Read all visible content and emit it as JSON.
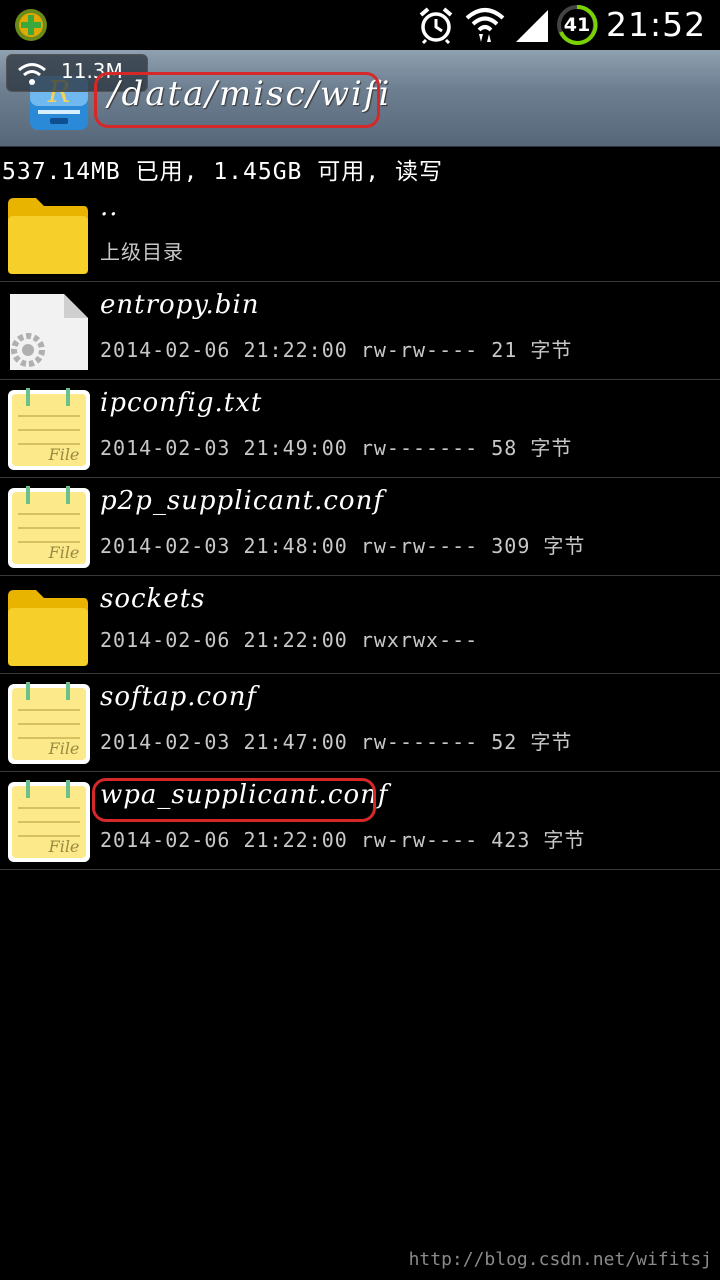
{
  "status_bar": {
    "battery_level": "41",
    "time": "21:52",
    "icons": [
      "app-notification-icon",
      "alarm-icon",
      "wifi-icon",
      "signal-icon",
      "battery-icon"
    ]
  },
  "title_bar": {
    "speed": "11.3M",
    "path": "/data/misc/wifi"
  },
  "storage_info": "537.14MB 已用, 1.45GB 可用, 读写",
  "files": [
    {
      "name": "..",
      "meta": "上级目录",
      "type": "folder"
    },
    {
      "name": "entropy.bin",
      "meta": "2014-02-06 21:22:00 rw-rw---- 21 字节",
      "type": "binary"
    },
    {
      "name": "ipconfig.txt",
      "meta": "2014-02-03 21:49:00 rw------- 58 字节",
      "type": "text"
    },
    {
      "name": "p2p_supplicant.conf",
      "meta": "2014-02-03 21:48:00 rw-rw---- 309 字节",
      "type": "text"
    },
    {
      "name": "sockets",
      "meta": "2014-02-06 21:22:00 rwxrwx---",
      "type": "folder"
    },
    {
      "name": "softap.conf",
      "meta": "2014-02-03 21:47:00 rw------- 52 字节",
      "type": "text"
    },
    {
      "name": "wpa_supplicant.conf",
      "meta": "2014-02-06 21:22:00 rw-rw---- 423 字节",
      "type": "text"
    }
  ],
  "watermark": "http://blog.csdn.net/wifitsj",
  "colors": {
    "highlight": "#d62828",
    "folder": "#f5c518",
    "titlebar": "#6d7f91"
  }
}
